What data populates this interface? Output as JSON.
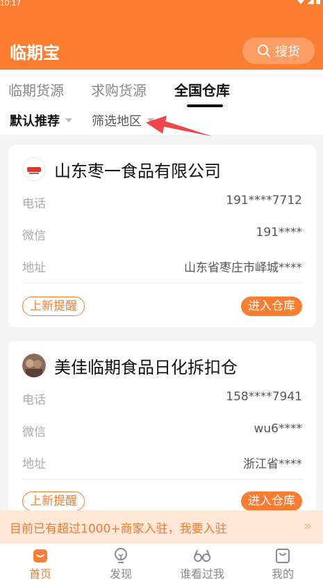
{
  "status": {
    "time": "10:17"
  },
  "header": {
    "title": "临期宝",
    "search_label": "搜货"
  },
  "tabs": [
    {
      "label": "临期货源"
    },
    {
      "label": "求购货源"
    },
    {
      "label": "全国仓库"
    }
  ],
  "filters": {
    "sort_label": "默认推荐",
    "region_label": "筛选地区"
  },
  "warehouses": [
    {
      "name": "山东枣一食品有限公司",
      "phone_label": "电话",
      "phone": "191****7712",
      "wechat_label": "微信",
      "wechat": "191****",
      "address_label": "地址",
      "address": "山东省枣庄市峄城****",
      "notify_label": "上新提醒",
      "enter_label": "进入仓库",
      "logo_icon": "zaoyi-brand-logo"
    },
    {
      "name": "美佳临期食品日化拆扣仓",
      "phone_label": "电话",
      "phone": "158****7941",
      "wechat_label": "微信",
      "wechat": "wu6****",
      "address_label": "地址",
      "address": "浙江省****",
      "notify_label": "上新提醒",
      "enter_label": "进入仓库",
      "logo_icon": "avatar-photo"
    }
  ],
  "banner": {
    "text": "目前已有超过1000+商家入驻，我要入驻",
    "chevron": "»"
  },
  "nav": [
    {
      "label": "首页",
      "icon": "home-bag-icon",
      "active": true
    },
    {
      "label": "发现",
      "icon": "bulb-icon",
      "active": false
    },
    {
      "label": "谁看过我",
      "icon": "glasses-icon",
      "active": false
    },
    {
      "label": "我的",
      "icon": "bag-icon",
      "active": false
    }
  ],
  "colors": {
    "accent": "#fb7d32",
    "banner_bg": "#fde8d8",
    "page_bg": "#f4f4f4"
  }
}
